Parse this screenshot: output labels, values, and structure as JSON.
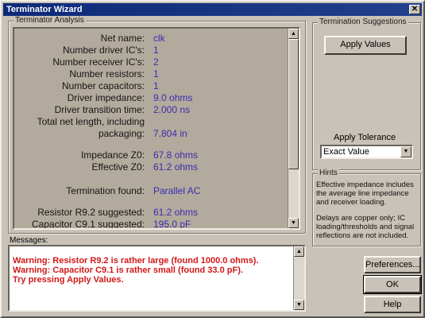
{
  "window": {
    "title": "Terminator Wizard",
    "close_glyph": "✕"
  },
  "analysis": {
    "group_label": "Terminator Analysis",
    "rows": [
      {
        "label": "Net name:",
        "value": "clk"
      },
      {
        "label": "Number driver IC's:",
        "value": "1"
      },
      {
        "label": "Number receiver IC's:",
        "value": "2"
      },
      {
        "label": "Number resistors:",
        "value": "1"
      },
      {
        "label": "Number capacitors:",
        "value": "1"
      },
      {
        "label": "Driver impedance:",
        "value": "9.0 ohms"
      },
      {
        "label": "Driver transition time:",
        "value": "2.000 ns"
      },
      {
        "label": "Total net length, including",
        "value": ""
      },
      {
        "label": "packaging:",
        "value": "7.804 in"
      },
      {
        "label": "Impedance Z0:",
        "value": "67.8 ohms"
      },
      {
        "label": "Effective Z0:",
        "value": "61.2 ohms"
      },
      {
        "label": "Termination found:",
        "value": "Parallel AC"
      },
      {
        "label": "Resistor R9.2 suggested:",
        "value": "61.2 ohms"
      },
      {
        "label": "Capacitor C9.1 suggested:",
        "value": "195.0 pF"
      }
    ]
  },
  "suggestions": {
    "group_label": "Termination Suggestions",
    "apply_values_label": "Apply Values",
    "apply_tolerance_label": "Apply Tolerance",
    "tolerance_selected": "Exact Value"
  },
  "hints": {
    "group_label": "Hints",
    "items": [
      "Effective impedance includes the average line impedance and receiver loading.",
      "Delays are copper only; IC loading/thresholds and signal reflections are not included."
    ]
  },
  "messages": {
    "label": "Messages:",
    "items": [
      "Warning: Resistor R9.2 is rather large (found 1000.0 ohms).",
      "Warning: Capacitor C9.1 is rather small (found 33.0 pF).",
      "Try pressing Apply Values."
    ]
  },
  "buttons": {
    "preferences": "Preferences...",
    "ok": "OK",
    "help": "Help"
  },
  "colors": {
    "title_bar": "#0c2a78",
    "value_text": "#3b2db0",
    "warning_text": "#d21818"
  }
}
